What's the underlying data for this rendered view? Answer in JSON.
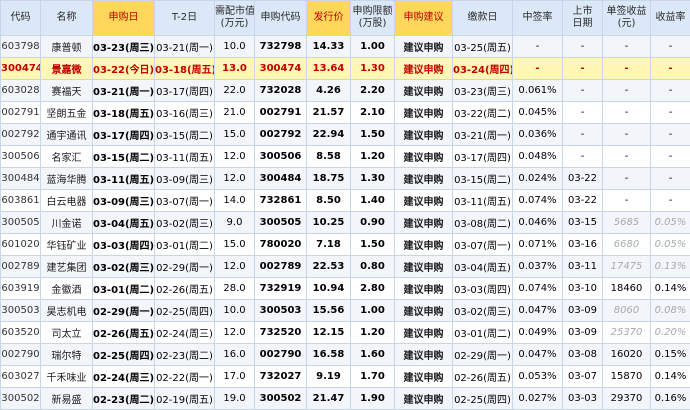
{
  "columns": [
    {
      "key": "code",
      "label": "代码"
    },
    {
      "key": "name",
      "label": "名称"
    },
    {
      "key": "subscribe_date",
      "label": "申购日",
      "highlight": true
    },
    {
      "key": "t2_date",
      "label": "T-2日"
    },
    {
      "key": "alloc_value",
      "label": "需配市值\n(万元)"
    },
    {
      "key": "sub_code",
      "label": "申购代码"
    },
    {
      "key": "issue_price",
      "label": "发行价",
      "highlight": true
    },
    {
      "key": "sub_limit",
      "label": "申购限额\n(万股)"
    },
    {
      "key": "suggestion",
      "label": "申购建议",
      "highlight": true
    },
    {
      "key": "pay_date",
      "label": "缴款日"
    },
    {
      "key": "win_rate",
      "label": "中签率"
    },
    {
      "key": "list_date",
      "label": "上市\n日期"
    },
    {
      "key": "single_gain",
      "label": "单签收益\n(元)"
    },
    {
      "key": "yield",
      "label": "收益率"
    }
  ],
  "rows": [
    {
      "code": "603798",
      "name": "康普顿",
      "subscribe_date": "03-23(周三)",
      "t2_date": "03-21(周一)",
      "alloc_value": "10.0",
      "sub_code": "732798",
      "issue_price": "14.33",
      "sub_limit": "1.00",
      "suggestion": "建议申购",
      "pay_date": "03-25(周五)",
      "win_rate": "-",
      "list_date": "-",
      "single_gain": "-",
      "yield": "-",
      "today": false,
      "faded": false
    },
    {
      "code": "300474",
      "name": "景嘉微",
      "subscribe_date": "03-22(今日)",
      "t2_date": "03-18(周五)",
      "alloc_value": "13.0",
      "sub_code": "300474",
      "issue_price": "13.64",
      "sub_limit": "1.30",
      "suggestion": "建议申购",
      "pay_date": "03-24(周四)",
      "win_rate": "-",
      "list_date": "-",
      "single_gain": "-",
      "yield": "-",
      "today": true,
      "faded": false
    },
    {
      "code": "603028",
      "name": "赛福天",
      "subscribe_date": "03-21(周一)",
      "t2_date": "03-17(周四)",
      "alloc_value": "22.0",
      "sub_code": "732028",
      "issue_price": "4.26",
      "sub_limit": "2.20",
      "suggestion": "建议申购",
      "pay_date": "03-23(周三)",
      "win_rate": "0.061%",
      "list_date": "-",
      "single_gain": "-",
      "yield": "-",
      "today": false,
      "faded": false
    },
    {
      "code": "002791",
      "name": "坚朗五金",
      "subscribe_date": "03-18(周五)",
      "t2_date": "03-16(周三)",
      "alloc_value": "21.0",
      "sub_code": "002791",
      "issue_price": "21.57",
      "sub_limit": "2.10",
      "suggestion": "建议申购",
      "pay_date": "03-22(周二)",
      "win_rate": "0.045%",
      "list_date": "-",
      "single_gain": "-",
      "yield": "-",
      "today": false,
      "faded": false
    },
    {
      "code": "002792",
      "name": "通宇通讯",
      "subscribe_date": "03-17(周四)",
      "t2_date": "03-15(周二)",
      "alloc_value": "15.0",
      "sub_code": "002792",
      "issue_price": "22.94",
      "sub_limit": "1.50",
      "suggestion": "建议申购",
      "pay_date": "03-21(周一)",
      "win_rate": "0.036%",
      "list_date": "-",
      "single_gain": "-",
      "yield": "-",
      "today": false,
      "faded": false
    },
    {
      "code": "300506",
      "name": "名家汇",
      "subscribe_date": "03-15(周二)",
      "t2_date": "03-11(周五)",
      "alloc_value": "12.0",
      "sub_code": "300506",
      "issue_price": "8.58",
      "sub_limit": "1.20",
      "suggestion": "建议申购",
      "pay_date": "03-17(周四)",
      "win_rate": "0.048%",
      "list_date": "-",
      "single_gain": "-",
      "yield": "-",
      "today": false,
      "faded": false
    },
    {
      "code": "300484",
      "name": "蓝海华腾",
      "subscribe_date": "03-11(周五)",
      "t2_date": "03-09(周三)",
      "alloc_value": "12.0",
      "sub_code": "300484",
      "issue_price": "18.75",
      "sub_limit": "1.30",
      "suggestion": "建议申购",
      "pay_date": "03-15(周二)",
      "win_rate": "0.024%",
      "list_date": "03-22",
      "single_gain": "-",
      "yield": "-",
      "today": false,
      "faded": false
    },
    {
      "code": "603861",
      "name": "白云电器",
      "subscribe_date": "03-09(周三)",
      "t2_date": "03-07(周一)",
      "alloc_value": "14.0",
      "sub_code": "732861",
      "issue_price": "8.50",
      "sub_limit": "1.40",
      "suggestion": "建议申购",
      "pay_date": "03-11(周五)",
      "win_rate": "0.074%",
      "list_date": "03-22",
      "single_gain": "-",
      "yield": "-",
      "today": false,
      "faded": false
    },
    {
      "code": "300505",
      "name": "川金诺",
      "subscribe_date": "03-04(周五)",
      "t2_date": "03-02(周三)",
      "alloc_value": "9.0",
      "sub_code": "300505",
      "issue_price": "10.25",
      "sub_limit": "0.90",
      "suggestion": "建议申购",
      "pay_date": "03-08(周二)",
      "win_rate": "0.046%",
      "list_date": "03-15",
      "single_gain": "5685",
      "yield": "0.05%",
      "today": false,
      "faded": true
    },
    {
      "code": "601020",
      "name": "华钰矿业",
      "subscribe_date": "03-03(周四)",
      "t2_date": "03-01(周二)",
      "alloc_value": "15.0",
      "sub_code": "780020",
      "issue_price": "7.18",
      "sub_limit": "1.50",
      "suggestion": "建议申购",
      "pay_date": "03-07(周一)",
      "win_rate": "0.071%",
      "list_date": "03-16",
      "single_gain": "6680",
      "yield": "0.05%",
      "today": false,
      "faded": true
    },
    {
      "code": "002789",
      "name": "建艺集团",
      "subscribe_date": "03-02(周三)",
      "t2_date": "02-29(周一)",
      "alloc_value": "12.0",
      "sub_code": "002789",
      "issue_price": "22.53",
      "sub_limit": "0.80",
      "suggestion": "建议申购",
      "pay_date": "03-04(周五)",
      "win_rate": "0.037%",
      "list_date": "03-11",
      "single_gain": "17475",
      "yield": "0.13%",
      "today": false,
      "faded": true
    },
    {
      "code": "603919",
      "name": "金徽酒",
      "subscribe_date": "03-01(周二)",
      "t2_date": "02-26(周五)",
      "alloc_value": "28.0",
      "sub_code": "732919",
      "issue_price": "10.94",
      "sub_limit": "2.80",
      "suggestion": "建议申购",
      "pay_date": "03-03(周四)",
      "win_rate": "0.074%",
      "list_date": "03-10",
      "single_gain": "18460",
      "yield": "0.14%",
      "today": false,
      "faded": false
    },
    {
      "code": "300503",
      "name": "昊志机电",
      "subscribe_date": "02-29(周一)",
      "t2_date": "02-25(周四)",
      "alloc_value": "10.0",
      "sub_code": "300503",
      "issue_price": "15.56",
      "sub_limit": "1.00",
      "suggestion": "建议申购",
      "pay_date": "03-02(周三)",
      "win_rate": "0.047%",
      "list_date": "03-09",
      "single_gain": "8060",
      "yield": "0.08%",
      "today": false,
      "faded": true
    },
    {
      "code": "603520",
      "name": "司太立",
      "subscribe_date": "02-26(周五)",
      "t2_date": "02-24(周三)",
      "alloc_value": "12.0",
      "sub_code": "732520",
      "issue_price": "12.15",
      "sub_limit": "1.20",
      "suggestion": "建议申购",
      "pay_date": "03-01(周二)",
      "win_rate": "0.049%",
      "list_date": "03-09",
      "single_gain": "25370",
      "yield": "0.20%",
      "today": false,
      "faded": true
    },
    {
      "code": "002790",
      "name": "瑞尔特",
      "subscribe_date": "02-25(周四)",
      "t2_date": "02-23(周二)",
      "alloc_value": "16.0",
      "sub_code": "002790",
      "issue_price": "16.58",
      "sub_limit": "1.60",
      "suggestion": "建议申购",
      "pay_date": "02-29(周一)",
      "win_rate": "0.047%",
      "list_date": "03-08",
      "single_gain": "16020",
      "yield": "0.15%",
      "today": false,
      "faded": false
    },
    {
      "code": "603027",
      "name": "千禾味业",
      "subscribe_date": "02-24(周三)",
      "t2_date": "02-22(周一)",
      "alloc_value": "17.0",
      "sub_code": "732027",
      "issue_price": "9.19",
      "sub_limit": "1.70",
      "suggestion": "建议申购",
      "pay_date": "02-26(周五)",
      "win_rate": "0.053%",
      "list_date": "03-07",
      "single_gain": "15870",
      "yield": "0.14%",
      "today": false,
      "faded": false
    },
    {
      "code": "300502",
      "name": "新易盛",
      "subscribe_date": "02-23(周二)",
      "t2_date": "02-19(周五)",
      "alloc_value": "19.0",
      "sub_code": "300502",
      "issue_price": "21.47",
      "sub_limit": "1.90",
      "suggestion": "建议申购",
      "pay_date": "02-25(周四)",
      "win_rate": "0.027%",
      "list_date": "03-03",
      "single_gain": "29370",
      "yield": "0.16%",
      "today": false,
      "faded": false
    }
  ]
}
